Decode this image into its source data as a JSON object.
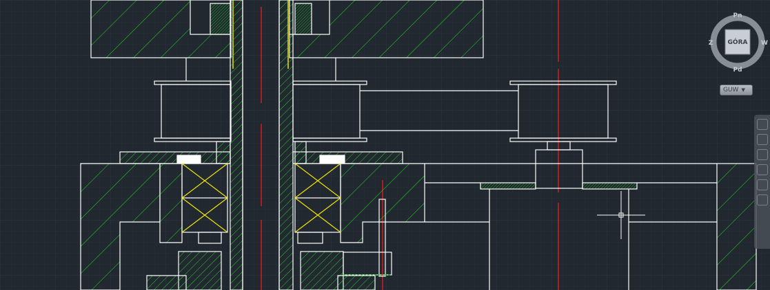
{
  "viewcube": {
    "top_face": "GÓRA",
    "north": "Pn",
    "south": "Pd",
    "west": "Z",
    "east": "W"
  },
  "wcs_menu": {
    "label": "GUW"
  },
  "colors": {
    "background": "#212830",
    "grid": "#2a323c",
    "outline": "#ffffff",
    "hatch": "#22d01f",
    "centerline": "#ff1a1a",
    "bearing": "#f0e600"
  }
}
